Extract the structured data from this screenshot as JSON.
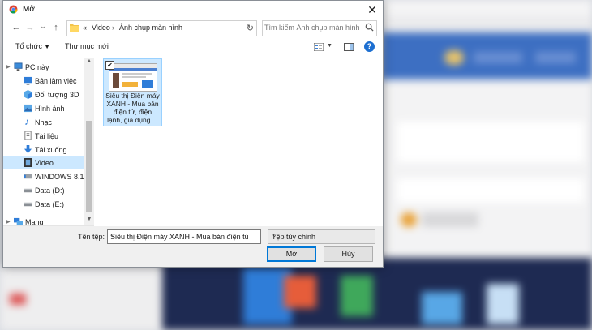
{
  "window": {
    "title": "Mở"
  },
  "nav_buttons": {
    "back": "←",
    "forward": "→",
    "dropdown": "⌄",
    "up": "↑"
  },
  "address": {
    "prefix": "«",
    "parts": [
      "Video",
      "Ảnh chụp màn hình"
    ],
    "separator": "›"
  },
  "search": {
    "placeholder": "Tìm kiếm Ảnh chụp màn hình"
  },
  "toolbar": {
    "organize": "Tổ chức",
    "new_folder": "Thư mục mới"
  },
  "nav_items": [
    {
      "label": "PC này",
      "icon": "computer-icon"
    },
    {
      "label": "Bản làm việc",
      "icon": "desktop-icon"
    },
    {
      "label": "Đối tượng 3D",
      "icon": "cube-icon"
    },
    {
      "label": "Hình ảnh",
      "icon": "pictures-icon"
    },
    {
      "label": "Nhạc",
      "icon": "music-icon"
    },
    {
      "label": "Tài liệu",
      "icon": "document-icon"
    },
    {
      "label": "Tải xuống",
      "icon": "download-icon"
    },
    {
      "label": "Video",
      "icon": "video-icon",
      "selected": true
    },
    {
      "label": "WINDOWS 8.1 (C",
      "icon": "drive-icon"
    },
    {
      "label": "Data (D:)",
      "icon": "drive-icon"
    },
    {
      "label": "Data (E:)",
      "icon": "drive-icon"
    },
    {
      "label": "Mạng",
      "icon": "network-icon"
    }
  ],
  "file": {
    "name": "Siêu thị Điện máy XANH - Mua bán điện tử, điện lạnh, gia dụng ...",
    "checked": true
  },
  "footer": {
    "filename_label": "Tên tệp:",
    "filename_value": "Siêu thị Điện máy XANH - Mua bán điện tử, điệ",
    "filetype_value": "Tệp tùy chỉnh",
    "open_label": "Mở",
    "cancel_label": "Hủy"
  },
  "colors": {
    "selection": "#cce8ff",
    "accent": "#0078d7"
  }
}
